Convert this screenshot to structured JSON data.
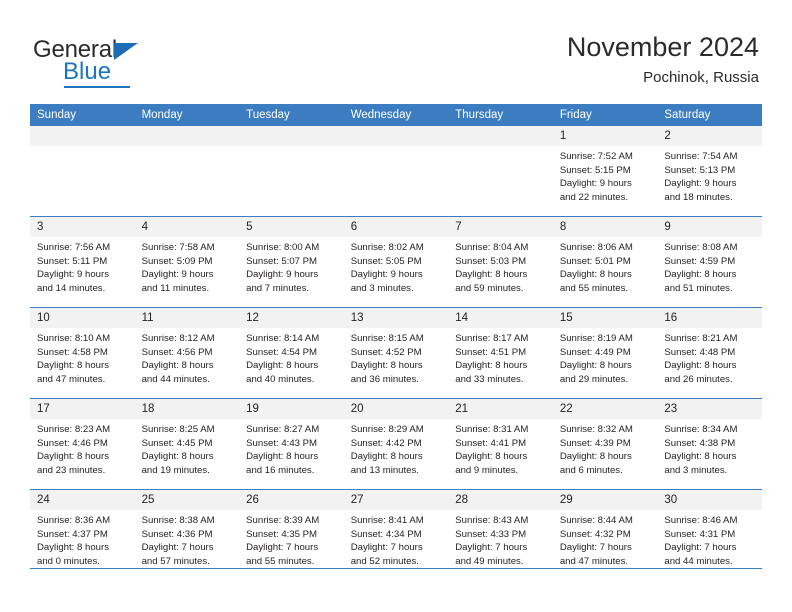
{
  "brand": {
    "name_part1": "General",
    "name_part2": "Blue"
  },
  "header": {
    "title": "November 2024",
    "location": "Pochinok, Russia"
  },
  "calendar": {
    "weekday_headers": [
      "Sunday",
      "Monday",
      "Tuesday",
      "Wednesday",
      "Thursday",
      "Friday",
      "Saturday"
    ],
    "colors": {
      "header_blue": "#3b7dc0",
      "daynum_band": "#f2f2f2",
      "text": "#231f20",
      "brand_blue": "#1d76bf"
    },
    "weeks": [
      [
        {
          "day": "",
          "empty": true,
          "lines": []
        },
        {
          "day": "",
          "empty": true,
          "lines": []
        },
        {
          "day": "",
          "empty": true,
          "lines": []
        },
        {
          "day": "",
          "empty": true,
          "lines": []
        },
        {
          "day": "",
          "empty": true,
          "lines": []
        },
        {
          "day": "1",
          "empty": false,
          "lines": [
            "Sunrise: 7:52 AM",
            "Sunset: 5:15 PM",
            "Daylight: 9 hours",
            "and 22 minutes."
          ]
        },
        {
          "day": "2",
          "empty": false,
          "lines": [
            "Sunrise: 7:54 AM",
            "Sunset: 5:13 PM",
            "Daylight: 9 hours",
            "and 18 minutes."
          ]
        }
      ],
      [
        {
          "day": "3",
          "empty": false,
          "lines": [
            "Sunrise: 7:56 AM",
            "Sunset: 5:11 PM",
            "Daylight: 9 hours",
            "and 14 minutes."
          ]
        },
        {
          "day": "4",
          "empty": false,
          "lines": [
            "Sunrise: 7:58 AM",
            "Sunset: 5:09 PM",
            "Daylight: 9 hours",
            "and 11 minutes."
          ]
        },
        {
          "day": "5",
          "empty": false,
          "lines": [
            "Sunrise: 8:00 AM",
            "Sunset: 5:07 PM",
            "Daylight: 9 hours",
            "and 7 minutes."
          ]
        },
        {
          "day": "6",
          "empty": false,
          "lines": [
            "Sunrise: 8:02 AM",
            "Sunset: 5:05 PM",
            "Daylight: 9 hours",
            "and 3 minutes."
          ]
        },
        {
          "day": "7",
          "empty": false,
          "lines": [
            "Sunrise: 8:04 AM",
            "Sunset: 5:03 PM",
            "Daylight: 8 hours",
            "and 59 minutes."
          ]
        },
        {
          "day": "8",
          "empty": false,
          "lines": [
            "Sunrise: 8:06 AM",
            "Sunset: 5:01 PM",
            "Daylight: 8 hours",
            "and 55 minutes."
          ]
        },
        {
          "day": "9",
          "empty": false,
          "lines": [
            "Sunrise: 8:08 AM",
            "Sunset: 4:59 PM",
            "Daylight: 8 hours",
            "and 51 minutes."
          ]
        }
      ],
      [
        {
          "day": "10",
          "empty": false,
          "lines": [
            "Sunrise: 8:10 AM",
            "Sunset: 4:58 PM",
            "Daylight: 8 hours",
            "and 47 minutes."
          ]
        },
        {
          "day": "11",
          "empty": false,
          "lines": [
            "Sunrise: 8:12 AM",
            "Sunset: 4:56 PM",
            "Daylight: 8 hours",
            "and 44 minutes."
          ]
        },
        {
          "day": "12",
          "empty": false,
          "lines": [
            "Sunrise: 8:14 AM",
            "Sunset: 4:54 PM",
            "Daylight: 8 hours",
            "and 40 minutes."
          ]
        },
        {
          "day": "13",
          "empty": false,
          "lines": [
            "Sunrise: 8:15 AM",
            "Sunset: 4:52 PM",
            "Daylight: 8 hours",
            "and 36 minutes."
          ]
        },
        {
          "day": "14",
          "empty": false,
          "lines": [
            "Sunrise: 8:17 AM",
            "Sunset: 4:51 PM",
            "Daylight: 8 hours",
            "and 33 minutes."
          ]
        },
        {
          "day": "15",
          "empty": false,
          "lines": [
            "Sunrise: 8:19 AM",
            "Sunset: 4:49 PM",
            "Daylight: 8 hours",
            "and 29 minutes."
          ]
        },
        {
          "day": "16",
          "empty": false,
          "lines": [
            "Sunrise: 8:21 AM",
            "Sunset: 4:48 PM",
            "Daylight: 8 hours",
            "and 26 minutes."
          ]
        }
      ],
      [
        {
          "day": "17",
          "empty": false,
          "lines": [
            "Sunrise: 8:23 AM",
            "Sunset: 4:46 PM",
            "Daylight: 8 hours",
            "and 23 minutes."
          ]
        },
        {
          "day": "18",
          "empty": false,
          "lines": [
            "Sunrise: 8:25 AM",
            "Sunset: 4:45 PM",
            "Daylight: 8 hours",
            "and 19 minutes."
          ]
        },
        {
          "day": "19",
          "empty": false,
          "lines": [
            "Sunrise: 8:27 AM",
            "Sunset: 4:43 PM",
            "Daylight: 8 hours",
            "and 16 minutes."
          ]
        },
        {
          "day": "20",
          "empty": false,
          "lines": [
            "Sunrise: 8:29 AM",
            "Sunset: 4:42 PM",
            "Daylight: 8 hours",
            "and 13 minutes."
          ]
        },
        {
          "day": "21",
          "empty": false,
          "lines": [
            "Sunrise: 8:31 AM",
            "Sunset: 4:41 PM",
            "Daylight: 8 hours",
            "and 9 minutes."
          ]
        },
        {
          "day": "22",
          "empty": false,
          "lines": [
            "Sunrise: 8:32 AM",
            "Sunset: 4:39 PM",
            "Daylight: 8 hours",
            "and 6 minutes."
          ]
        },
        {
          "day": "23",
          "empty": false,
          "lines": [
            "Sunrise: 8:34 AM",
            "Sunset: 4:38 PM",
            "Daylight: 8 hours",
            "and 3 minutes."
          ]
        }
      ],
      [
        {
          "day": "24",
          "empty": false,
          "lines": [
            "Sunrise: 8:36 AM",
            "Sunset: 4:37 PM",
            "Daylight: 8 hours",
            "and 0 minutes."
          ]
        },
        {
          "day": "25",
          "empty": false,
          "lines": [
            "Sunrise: 8:38 AM",
            "Sunset: 4:36 PM",
            "Daylight: 7 hours",
            "and 57 minutes."
          ]
        },
        {
          "day": "26",
          "empty": false,
          "lines": [
            "Sunrise: 8:39 AM",
            "Sunset: 4:35 PM",
            "Daylight: 7 hours",
            "and 55 minutes."
          ]
        },
        {
          "day": "27",
          "empty": false,
          "lines": [
            "Sunrise: 8:41 AM",
            "Sunset: 4:34 PM",
            "Daylight: 7 hours",
            "and 52 minutes."
          ]
        },
        {
          "day": "28",
          "empty": false,
          "lines": [
            "Sunrise: 8:43 AM",
            "Sunset: 4:33 PM",
            "Daylight: 7 hours",
            "and 49 minutes."
          ]
        },
        {
          "day": "29",
          "empty": false,
          "lines": [
            "Sunrise: 8:44 AM",
            "Sunset: 4:32 PM",
            "Daylight: 7 hours",
            "and 47 minutes."
          ]
        },
        {
          "day": "30",
          "empty": false,
          "lines": [
            "Sunrise: 8:46 AM",
            "Sunset: 4:31 PM",
            "Daylight: 7 hours",
            "and 44 minutes."
          ]
        }
      ]
    ]
  }
}
